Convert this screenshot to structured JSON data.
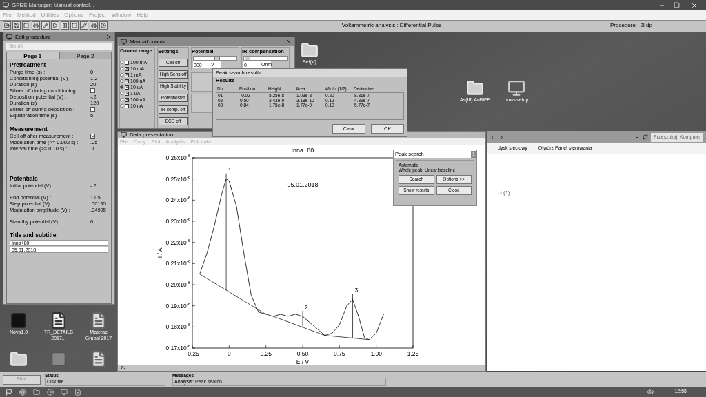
{
  "main_window": {
    "title": "GPES Manager: Manual control...",
    "menu": [
      "File",
      "Method",
      "Utilities",
      "Options",
      "Project",
      "Window",
      "Help"
    ],
    "status_text": "Voltammetric analysis : Differential Pulse",
    "procedure": "Procedure : 2l dp"
  },
  "edit_procedure": {
    "title": "Edit procedure",
    "field": "Sendfl",
    "tabs": [
      {
        "label": "Page 1",
        "selected": true
      },
      {
        "label": "Page 2",
        "selected": false
      }
    ],
    "sections": [
      {
        "heading": "Pretreatment",
        "rows": [
          {
            "kind": "value",
            "label": "Purge time (s) :",
            "value": "0"
          },
          {
            "kind": "value",
            "label": "Conditioning potential (V) :",
            "value": "1.2"
          },
          {
            "kind": "value",
            "label": "Duration (s) :",
            "value": "20"
          },
          {
            "kind": "checkbox",
            "label": "Stirrer off during conditioning :",
            "checked": false
          },
          {
            "kind": "value",
            "label": "Deposition potential (V) :",
            "value": "-.2"
          },
          {
            "kind": "value",
            "label": "Duration (s) :",
            "value": "120"
          },
          {
            "kind": "checkbox",
            "label": "Stirrer off during deposition :",
            "checked": false
          },
          {
            "kind": "value",
            "label": "Equilibration time (s) :",
            "value": "5"
          }
        ]
      },
      {
        "heading": "Measurement",
        "rows": [
          {
            "kind": "checkbox",
            "label": "Cell off after measurement :",
            "checked": true
          },
          {
            "kind": "value",
            "label": "Modulation time (>= 0.002 s) :",
            "value": ".05"
          },
          {
            "kind": "value",
            "label": "Interval time (>= 0.10 s) :",
            "value": ".1"
          }
        ]
      },
      {
        "heading": "Potentials",
        "rows": [
          {
            "kind": "value",
            "label": "Initial potential (V) :",
            "value": "-.2"
          },
          {
            "kind": "value",
            "label": "End potential (V) :",
            "value": "1.05"
          },
          {
            "kind": "value",
            "label": "Step potential (V) :",
            "value": ".00195"
          },
          {
            "kind": "value",
            "label": "Modulation amplitude (V) :",
            "value": ".04995"
          },
          {
            "kind": "value",
            "label": "Standby potential (V) :",
            "value": "0"
          }
        ]
      }
    ],
    "title_heading": "Title and subtitle",
    "title_fields": [
      "Inna+80",
      "05.01.2018"
    ]
  },
  "manual_control": {
    "title": "Manual control",
    "current_range": {
      "heading": "Current range",
      "items": [
        {
          "label": "100 mA",
          "selected": false,
          "checked": false
        },
        {
          "label": "10 mA",
          "selected": false,
          "checked": true
        },
        {
          "label": "1 mA",
          "selected": false,
          "checked": true
        },
        {
          "label": "100 uA",
          "selected": false,
          "checked": true
        },
        {
          "label": "10 uA",
          "selected": true,
          "checked": true
        },
        {
          "label": "1 uA",
          "selected": false,
          "checked": true
        },
        {
          "label": "100 nA",
          "selected": false,
          "checked": true
        },
        {
          "label": "10 nA",
          "selected": false,
          "checked": false
        }
      ]
    },
    "settings": {
      "heading": "Settings",
      "buttons": [
        "Cell off",
        "High Sens off",
        "High Stability",
        "Potentiostat",
        "iR-comp. off",
        "ECD off"
      ]
    },
    "potential": {
      "heading": "Potential",
      "value": "000",
      "unit": "V",
      "level": 0.55
    },
    "ir_compensation": {
      "heading": "iR-compensation",
      "value": "0",
      "unit": "Ohm",
      "level": 0.08
    }
  },
  "peak_results": {
    "title": "Peak search results",
    "heading": "Results",
    "columns": [
      "No.",
      "Position",
      "Height",
      "Area",
      "Width (1/2)",
      "Derivative"
    ],
    "rows": [
      [
        "01",
        "-0.02",
        "5.25e-8",
        "1.03e-8",
        "0.20",
        "8.31e-7"
      ],
      [
        "02",
        "0.50",
        "3.43e-9",
        "3.18e-10",
        "0.12",
        "4.89e-7"
      ],
      [
        "03",
        "0.84",
        "1.75e-8",
        "1.77e-9",
        "0.10",
        "5.77e-7"
      ]
    ],
    "buttons": [
      "Clear",
      "OK"
    ]
  },
  "data_presentation": {
    "title": "Data presentation",
    "menu": [
      "File",
      "Copy",
      "Plot",
      "Analysis",
      "Edit data"
    ],
    "status": "Zz..",
    "chart_data": {
      "type": "line",
      "title": "Inna+80",
      "xlabel": "E / V",
      "ylabel": "I / A",
      "xlim": [
        -0.25,
        1.25
      ],
      "ylim": [
        1.7e-07,
        2.6e-07
      ],
      "xticks": [
        -0.25,
        {
          "value": 0,
          "label": "0"
        },
        0.25,
        {
          "value": 0.5,
          "label": "0.50"
        },
        0.75,
        {
          "value": 1.0,
          "label": "1.00"
        },
        1.25
      ],
      "yticks": [
        {
          "value": 1.7e-07,
          "label": "0.17x10$^{-6}$"
        },
        {
          "value": 1.8e-07,
          "label": "0.18x10$^{-6}$"
        },
        {
          "value": 1.9e-07,
          "label": "0.19x10$^{-6}$"
        },
        {
          "value": 2e-07,
          "label": "0.20x10$^{-6}$"
        },
        {
          "value": 2.1e-07,
          "label": "0.21x10$^{-6}$"
        },
        {
          "value": 2.2e-07,
          "label": "0.22x10$^{-6}$"
        },
        {
          "value": 2.3e-07,
          "label": "0.23x10$^{-6}$"
        },
        {
          "value": 2.4e-07,
          "label": "0.24x10$^{-6}$"
        },
        {
          "value": 2.5e-07,
          "label": "0.25x10$^{-6}$"
        },
        {
          "value": 2.6e-07,
          "label": "0.26x10$^{-6}$"
        }
      ],
      "x": [
        -0.2,
        -0.15,
        -0.1,
        -0.05,
        -0.02,
        0.0,
        0.05,
        0.1,
        0.15,
        0.2,
        0.25,
        0.3,
        0.35,
        0.4,
        0.45,
        0.5,
        0.55,
        0.6,
        0.65,
        0.7,
        0.75,
        0.8,
        0.84,
        0.88,
        0.92,
        0.95,
        1.0,
        1.05
      ],
      "series": [
        {
          "color": "#000000",
          "values": [
            2.05e-07,
            2.15e-07,
            2.28e-07,
            2.43e-07,
            2.5e-07,
            2.49e-07,
            2.37e-07,
            2.15e-07,
            1.95e-07,
            1.87e-07,
            1.86e-07,
            1.85e-07,
            1.86e-07,
            1.85e-07,
            1.86e-07,
            1.85e-07,
            1.82e-07,
            1.79e-07,
            1.76e-07,
            1.77e-07,
            1.81e-07,
            1.9e-07,
            1.93e-07,
            1.85e-07,
            1.75e-07,
            1.74e-07,
            1.77e-07,
            1.86e-07
          ]
        }
      ],
      "annotations": [
        "05.01.2018",
        {
          "text": "1",
          "x": -0.02,
          "y": 2.5e-07
        },
        {
          "text": "2",
          "x": 0.5,
          "y": 1.85e-07
        },
        {
          "text": "3",
          "x": 0.84,
          "y": 1.93e-07
        }
      ]
    }
  },
  "peak_search": {
    "title": "Peak search",
    "badge": "1",
    "mode": "Automatic",
    "description": "Whole peak, Linear baseline",
    "buttons": [
      "Search",
      "Options >>",
      "Show results",
      "Close"
    ]
  },
  "explorer": {
    "links": [
      "dysk sieciowy",
      "Otwórz Panel sterowania"
    ],
    "search_placeholder": "Przeszukaj: Komputer",
    "group": "ci (1)"
  },
  "desktop_icons": [
    {
      "kind": "folder",
      "label": "Set(V)"
    },
    {
      "kind": "folder",
      "label": "As(III) AuBiFE"
    },
    {
      "kind": "setup",
      "label": "nova-setup"
    },
    {
      "kind": "app",
      "label": "Nova1.9"
    },
    {
      "kind": "pdf",
      "label": "TR_DETAILS 2017..."
    },
    {
      "kind": "word",
      "label": "Materac Grubal 2017"
    },
    {
      "kind": "folder"
    },
    {
      "kind": "shortcut"
    },
    {
      "kind": "word"
    }
  ],
  "bottom_status": {
    "start": "Start",
    "status_label": "Status",
    "status": "Disk file",
    "messages_label": "Messages",
    "message": "Analysis: Peak search"
  },
  "taskbar": {
    "clock": "12:55"
  }
}
